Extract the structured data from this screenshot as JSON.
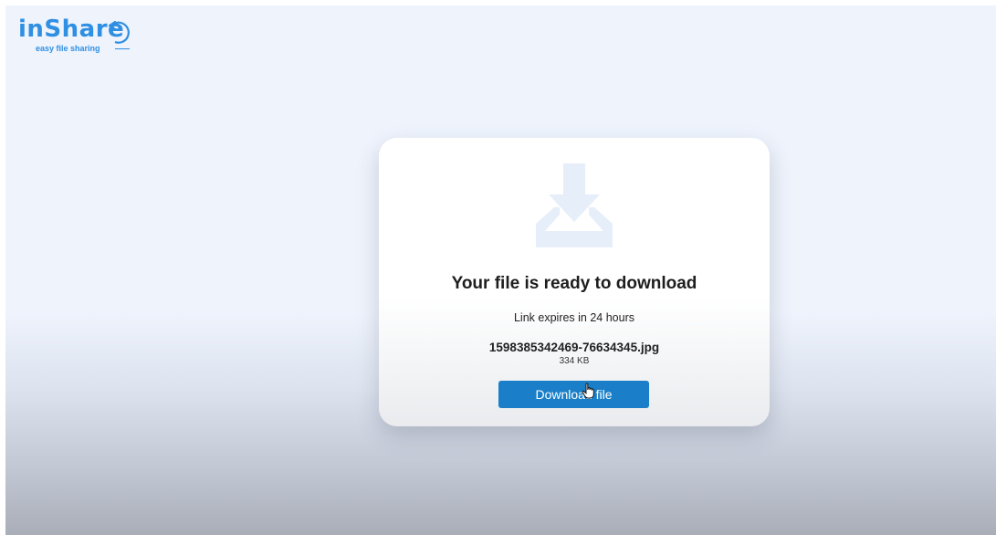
{
  "brand": {
    "name": "inShare",
    "tagline": "easy file sharing",
    "color": "#2f8fe3"
  },
  "download_card": {
    "icon": "download-icon",
    "title": "Your file is ready to download",
    "expiry_text": "Link expires in 24 hours",
    "file_name": "1598385342469-76634345.jpg",
    "file_size": "334 KB",
    "button_label": "Download file",
    "button_color": "#1a7fc8"
  },
  "cursor": "hand-pointer-icon"
}
